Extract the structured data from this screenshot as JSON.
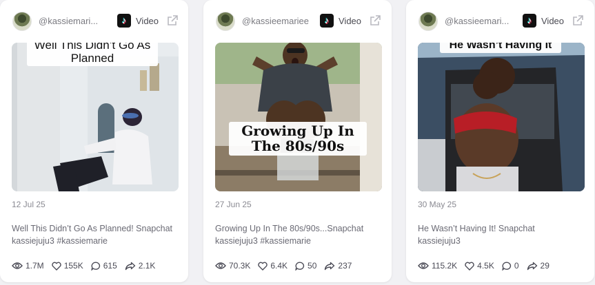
{
  "cards": [
    {
      "username": "@kassiemari...",
      "type_label": "Video",
      "overlay": "Well This Didn’t Go As Planned",
      "date": "12 Jul 25",
      "description": "Well This Didn’t Go As Planned! Snapchat kassiejuju3 #kassiemarie",
      "stats": {
        "views": "1.7M",
        "likes": "155K",
        "comments": "615",
        "shares": "2.1K"
      }
    },
    {
      "username": "@kassieemariee",
      "type_label": "Video",
      "overlay": "Growing Up In The 80s/90s",
      "date": "27 Jun 25",
      "description": "Growing Up In The 80s/90s...Snapchat kassiejuju3 #kassiemarie",
      "stats": {
        "views": "70.3K",
        "likes": "6.4K",
        "comments": "50",
        "shares": "237"
      }
    },
    {
      "username": "@kassieemari...",
      "type_label": "Video",
      "overlay": "He Wasn’t Having It",
      "date": "30 May 25",
      "description": "He Wasn’t Having It! Snapchat kassiejuju3",
      "stats": {
        "views": "115.2K",
        "likes": "4.5K",
        "comments": "0",
        "shares": "29"
      }
    }
  ],
  "colors": {
    "page_bg": "#f1f1f4",
    "card_bg": "#ffffff",
    "muted_text": "#7a7a80"
  },
  "icons": [
    "tiktok-icon",
    "external-link-icon",
    "eye-icon",
    "heart-icon",
    "comment-icon",
    "share-icon"
  ]
}
